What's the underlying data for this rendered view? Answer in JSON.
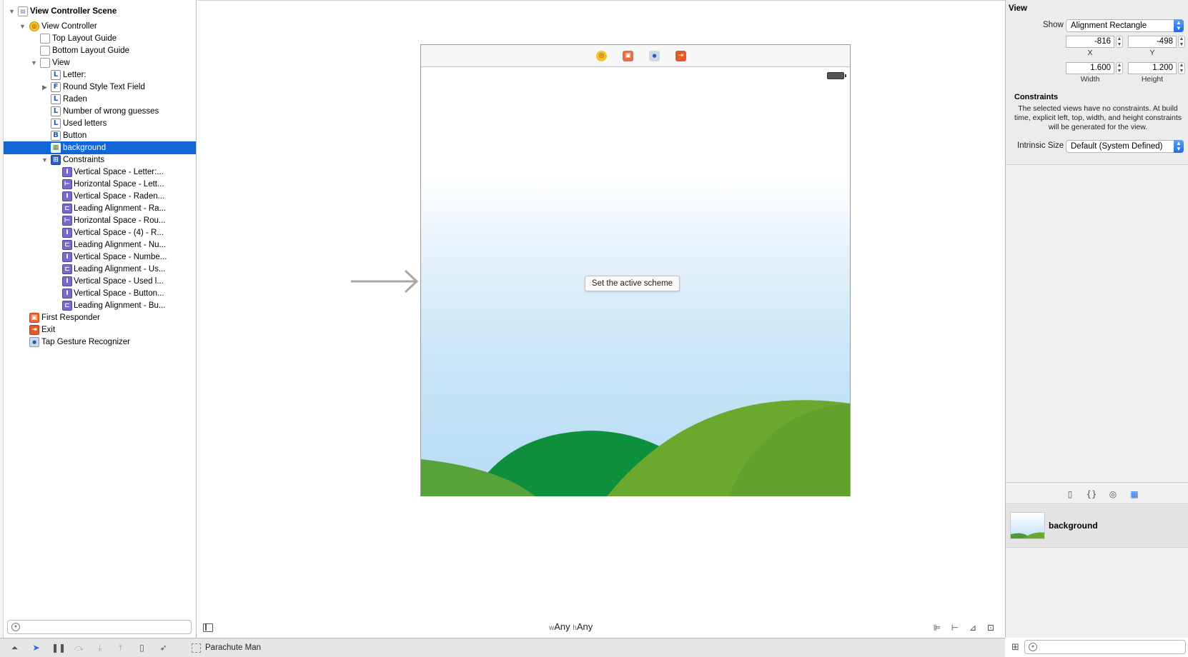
{
  "outline": {
    "rows": [
      {
        "label": "View Controller Scene",
        "icon": "scene-icon"
      },
      {
        "label": "View Controller",
        "icon": "view-controller-icon"
      },
      {
        "label": "Top Layout Guide",
        "icon": "layout-guide-icon"
      },
      {
        "label": "Bottom Layout Guide",
        "icon": "layout-guide-icon"
      },
      {
        "label": "View",
        "icon": "view-icon"
      },
      {
        "label": "Letter:",
        "icon": "label-icon",
        "glyph": "L"
      },
      {
        "label": "Round Style Text Field",
        "icon": "text-field-icon",
        "glyph": "F"
      },
      {
        "label": "Raden",
        "icon": "label-icon",
        "glyph": "L"
      },
      {
        "label": "Number of wrong guesses",
        "icon": "label-icon",
        "glyph": "L"
      },
      {
        "label": "Used letters",
        "icon": "label-icon",
        "glyph": "L"
      },
      {
        "label": "Button",
        "icon": "button-icon",
        "glyph": "B"
      },
      {
        "label": "background",
        "icon": "image-view-icon"
      },
      {
        "label": "Constraints",
        "icon": "constraints-icon"
      },
      {
        "label": "Vertical Space - Letter:...",
        "icon": "constraint-icon"
      },
      {
        "label": "Horizontal Space - Lett...",
        "icon": "constraint-icon"
      },
      {
        "label": "Vertical Space - Raden...",
        "icon": "constraint-icon"
      },
      {
        "label": "Leading Alignment - Ra...",
        "icon": "constraint-icon"
      },
      {
        "label": "Horizontal Space - Rou...",
        "icon": "constraint-icon"
      },
      {
        "label": "Vertical Space - (4) - R...",
        "icon": "constraint-icon"
      },
      {
        "label": "Leading Alignment - Nu...",
        "icon": "constraint-icon"
      },
      {
        "label": "Vertical Space - Numbe...",
        "icon": "constraint-icon"
      },
      {
        "label": "Leading Alignment - Us...",
        "icon": "constraint-icon"
      },
      {
        "label": "Vertical Space - Used l...",
        "icon": "constraint-icon"
      },
      {
        "label": "Vertical Space - Button...",
        "icon": "constraint-icon"
      },
      {
        "label": "Leading Alignment - Bu...",
        "icon": "constraint-icon"
      },
      {
        "label": "First Responder",
        "icon": "first-responder-icon"
      },
      {
        "label": "Exit",
        "icon": "exit-icon"
      },
      {
        "label": "Tap Gesture Recognizer",
        "icon": "tap-gesture-icon"
      }
    ],
    "selected": "background"
  },
  "canvas": {
    "scheme_button": "Set the active scheme",
    "size_class": {
      "w_prefix": "w",
      "w_value": "Any",
      "h_prefix": "h",
      "h_value": "Any"
    }
  },
  "inspector": {
    "title": "View",
    "show_label": "Show",
    "show_value": "Alignment Rectangle",
    "x_value": "-816",
    "y_value": "-498",
    "x_label": "X",
    "y_label": "Y",
    "width_value": "1.600",
    "height_value": "1.200",
    "width_label": "Width",
    "height_label": "Height",
    "constraints_title": "Constraints",
    "constraints_message": "The selected views have no constraints. At build time, explicit left, top, width, and height constraints will be generated for the view.",
    "intrinsic_label": "Intrinsic Size",
    "intrinsic_value": "Default (System Defined)",
    "library_item": "background"
  },
  "debugbar": {
    "scheme_name": "Parachute Man"
  },
  "colors": {
    "selection": "#1066d6",
    "accent": "#1d6ae8",
    "hill_dark": "#0e8f3c",
    "hill_light": "#73ad2a"
  }
}
